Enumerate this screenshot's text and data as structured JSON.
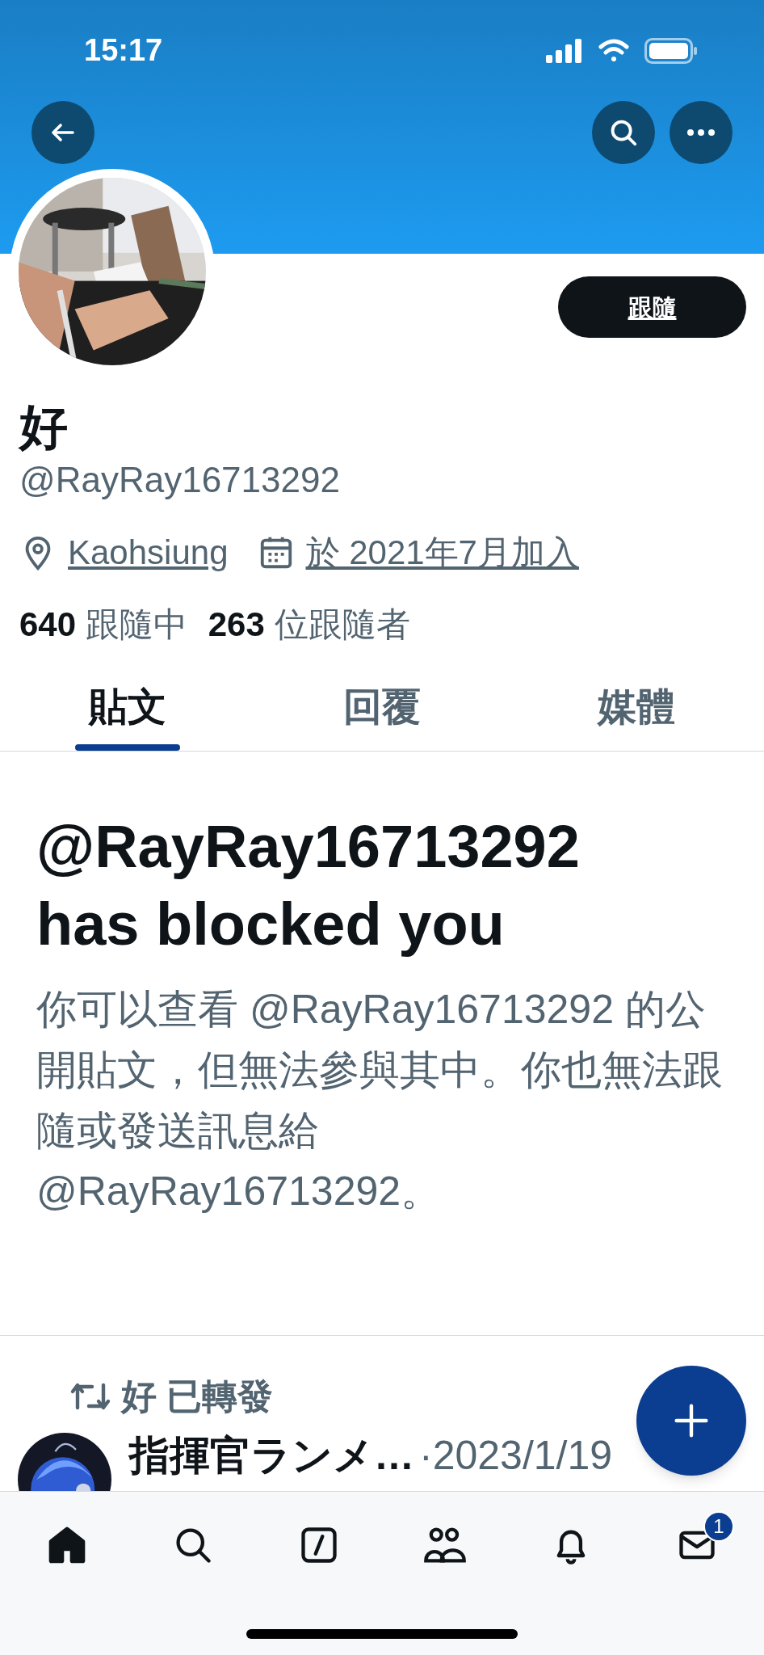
{
  "status_bar": {
    "time": "15:17"
  },
  "profile": {
    "follow_button": "跟隨",
    "name": "好",
    "handle": "@RayRay16713292",
    "location": "Kaohsiung",
    "joined": "於 2021年7月加入",
    "stats": [
      {
        "count": "640",
        "label": "跟隨中"
      },
      {
        "count": "263",
        "label": "位跟隨者"
      }
    ]
  },
  "tabs": [
    {
      "label": "貼文",
      "selected": true
    },
    {
      "label": "回覆",
      "selected": false
    },
    {
      "label": "媒體",
      "selected": false
    }
  ],
  "blocked_notice": {
    "title": "@RayRay16713292 has blocked you",
    "body": "你可以查看 @RayRay16713292 的公開貼文，但無法參與其中。你也無法跟隨或發送訊息給 @RayRay16713292。"
  },
  "post": {
    "repost_label": "好 已轉發",
    "author": "指揮官ランメ…",
    "date": "·2023/1/19"
  },
  "bottom_nav": [
    {
      "kind": "home",
      "selected": true
    },
    {
      "kind": "search",
      "selected": false
    },
    {
      "kind": "compose",
      "selected": false
    },
    {
      "kind": "communities",
      "selected": false
    },
    {
      "kind": "notifications",
      "selected": false
    },
    {
      "kind": "messages",
      "selected": false,
      "badge": "1"
    }
  ]
}
